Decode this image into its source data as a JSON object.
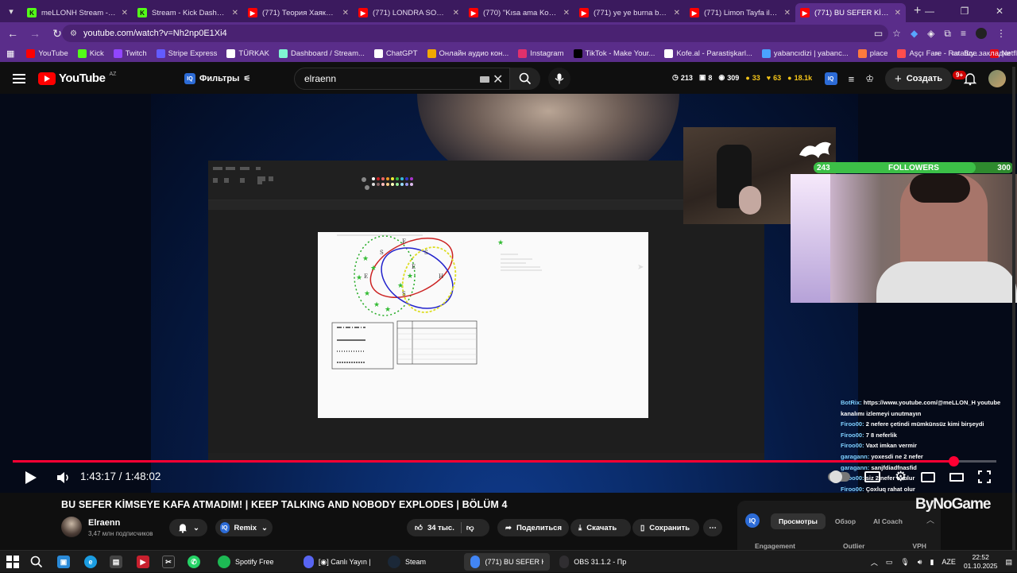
{
  "browser": {
    "tabs": [
      {
        "title": "meLLONH Stream - Watc",
        "icon": "kick-icon",
        "color": "#53fc18",
        "active": false
      },
      {
        "title": "Stream - Kick Dashboard",
        "icon": "kick-icon",
        "color": "#53fc18",
        "active": false
      },
      {
        "title": "(771) Теория Хаяка в Чел",
        "icon": "youtube-icon",
        "color": "#ff0000",
        "active": false
      },
      {
        "title": "(771) LONDRA SOKAK LEZ",
        "icon": "youtube-icon",
        "color": "#ff0000",
        "active": false
      },
      {
        "title": "(770) \"Kısa ama Komik\" K",
        "icon": "youtube-icon",
        "color": "#ff0000",
        "active": false
      },
      {
        "title": "(771) ye ye burna boy - Y",
        "icon": "youtube-icon",
        "color": "#ff0000",
        "active": false
      },
      {
        "title": "(771) Limon Tayfa ile Bom",
        "icon": "youtube-icon",
        "color": "#ff0000",
        "active": false
      },
      {
        "title": "(771) BU SEFER KİMSEYE",
        "icon": "youtube-icon",
        "color": "#ff0000",
        "active": true
      }
    ],
    "new_tab": "+",
    "url": "youtube.com/watch?v=Nh2np0E1Xi4",
    "bookmarks": [
      {
        "label": "YouTube",
        "icon": "youtube-icon",
        "color": "#ff0000"
      },
      {
        "label": "Kick",
        "icon": "kick-icon",
        "color": "#53fc18"
      },
      {
        "label": "Twitch",
        "icon": "twitch-icon",
        "color": "#9146ff"
      },
      {
        "label": "Stripe Express",
        "icon": "stripe-icon",
        "color": "#635bff"
      },
      {
        "label": "TÜRKAK",
        "icon": "turkak-icon",
        "color": "#ffffff"
      },
      {
        "label": "Dashboard / Stream...",
        "icon": "streamlabs-icon",
        "color": "#80f5d2"
      },
      {
        "label": "ChatGPT",
        "icon": "chatgpt-icon",
        "color": "#ffffff"
      },
      {
        "label": "Онлайн аудио кон...",
        "icon": "audio-converter-icon",
        "color": "#f2a900"
      },
      {
        "label": "Instagram",
        "icon": "instagram-icon",
        "color": "#e1306c"
      },
      {
        "label": "TikTok - Make Your...",
        "icon": "tiktok-icon",
        "color": "#000000"
      },
      {
        "label": "Kofe.al - Parastişkarl...",
        "icon": "kofe-icon",
        "color": "#ffffff"
      },
      {
        "label": "yabancıdizi | yabanc...",
        "icon": "globe-icon",
        "color": "#4aa3ff"
      },
      {
        "label": "place",
        "icon": "place-icon",
        "color": "#ff7a3d"
      },
      {
        "label": "Aşçı Fare - Ratatuy...",
        "icon": "film-icon",
        "color": "#ff4d4d"
      },
      {
        "label": "Netflix",
        "icon": "netflix-icon",
        "color": "#e50914"
      }
    ],
    "bookmarks_more": "»",
    "all_bookmarks": "Все закладки"
  },
  "youtube": {
    "logo": "YouTube",
    "region": "AZ",
    "filters_label": "Фильтры",
    "search_value": "elraenn",
    "stats": [
      {
        "icon": "clock-icon",
        "value": "213"
      },
      {
        "icon": "video-icon",
        "value": "8"
      },
      {
        "icon": "eye-icon",
        "value": "309"
      },
      {
        "icon": "coin-icon",
        "value": "33",
        "color": "#f5c518"
      },
      {
        "icon": "like-icon",
        "value": "63",
        "color": "#f5c518"
      },
      {
        "icon": "views-icon",
        "value": "18.1k",
        "color": "#f5c518"
      }
    ],
    "create_label": "Создать",
    "notifications": "9+"
  },
  "player": {
    "current_time": "1:43:17",
    "separator": " / ",
    "duration": "1:48:02",
    "progress": 0.956,
    "followers_current": "243",
    "followers_label": "FOLLOWERS",
    "followers_goal": "300",
    "chat": [
      {
        "user": "BotRix:",
        "text": "https://www.youtube.com/@meLLON_H youtube kanalımı izlemeyi unutmayın"
      },
      {
        "user": "Firoo00:",
        "text": "2 nefere çetindi mümkünsüz kimi birşeydi"
      },
      {
        "user": "Firoo00:",
        "text": "7 8 neferlik"
      },
      {
        "user": "Firoo00:",
        "text": "Vaxt imkan vermir"
      },
      {
        "user": "garagann:",
        "text": "yoxesdi ne 2 nefer"
      },
      {
        "user": "garagann:",
        "text": "sanjfdiadfnasfid"
      },
      {
        "user": "Firoo00:",
        "text": "siz 2 nefer oxulur"
      },
      {
        "user": "Firoo00:",
        "text": "Çoxluq rahat olur"
      }
    ]
  },
  "video": {
    "title": "BU SEFER KİMSEYE KAFA ATMADIM! | KEEP TALKING AND NOBODY EXPLODES | BÖLÜM 4",
    "channel": "Elraenn",
    "subscribers": "3,47 млн подписчиков",
    "remix_label": "Remix",
    "likes": "34 тыс.",
    "share_label": "Поделиться",
    "download_label": "Скачать",
    "save_label": "Сохранить",
    "watermark": "ByNoGame"
  },
  "iq_panel": {
    "tabs": [
      "Просмотры",
      "Обзор",
      "AI Coach"
    ],
    "active_tab": "Просмотры",
    "columns": [
      "Engagement",
      "Outlier",
      "VPH"
    ]
  },
  "taskbar": {
    "apps": [
      {
        "label": "Spotify Free",
        "icon": "spotify-icon",
        "color": "#1db954"
      },
      {
        "label": "[◉] Canlı Yayın | V...",
        "icon": "discord-icon",
        "color": "#5865f2"
      },
      {
        "label": "Steam",
        "icon": "steam-icon",
        "color": "#1b2838"
      },
      {
        "label": "(771) BU SEFER KİM...",
        "icon": "chrome-icon",
        "color": "#4285f4",
        "active": true
      },
      {
        "label": "OBS 31.1.2 - Проф...",
        "icon": "obs-icon",
        "color": "#302e31"
      }
    ],
    "language": "AZE",
    "time": "22:52",
    "date": "01.10.2025"
  }
}
